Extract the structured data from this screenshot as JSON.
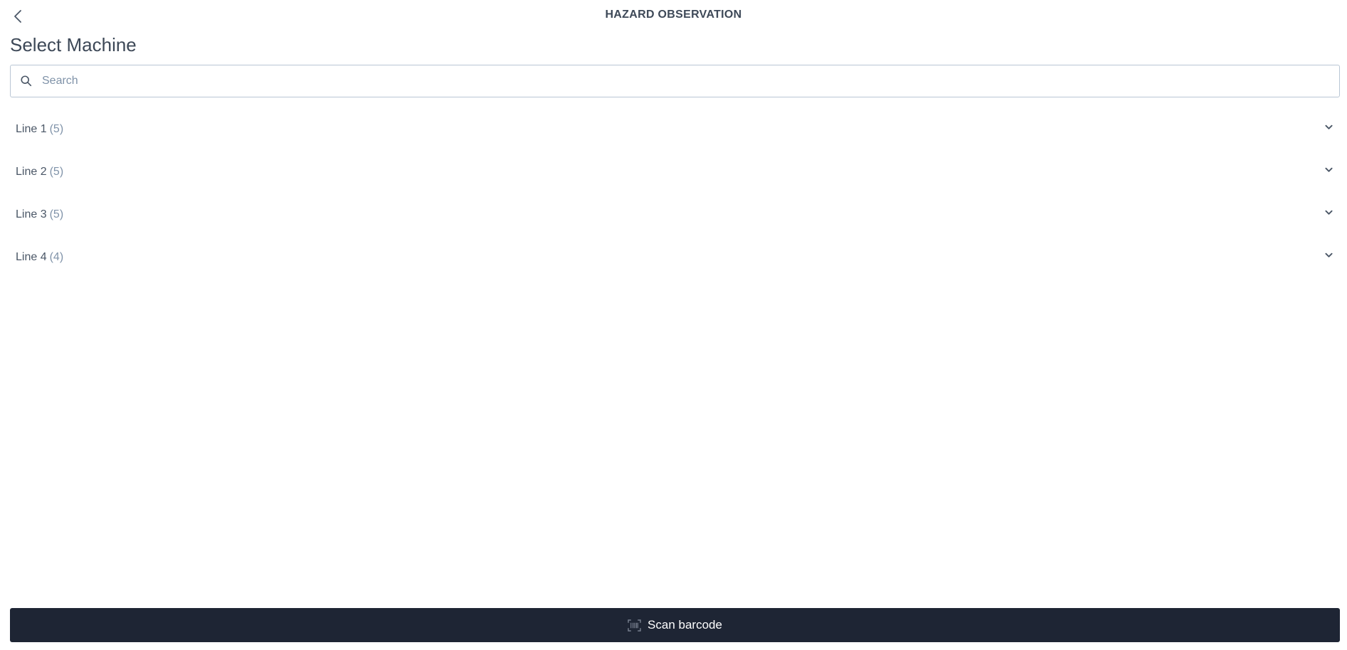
{
  "header": {
    "title": "HAZARD OBSERVATION",
    "back_icon": "chevron-left-icon"
  },
  "page": {
    "title": "Select Machine"
  },
  "search": {
    "placeholder": "Search",
    "value": "",
    "icon": "search-icon"
  },
  "groups": [
    {
      "label": "Line 1",
      "count": "(5)",
      "expanded": false
    },
    {
      "label": "Line 2",
      "count": "(5)",
      "expanded": false
    },
    {
      "label": "Line 3",
      "count": "(5)",
      "expanded": false
    },
    {
      "label": "Line 4",
      "count": "(4)",
      "expanded": false
    }
  ],
  "footer": {
    "scan_label": "Scan barcode",
    "scan_icon": "barcode-icon"
  },
  "colors": {
    "primary_dark": "#1e2534",
    "text": "#3d4857",
    "muted": "#8093a9",
    "border": "#b9c6d4"
  }
}
